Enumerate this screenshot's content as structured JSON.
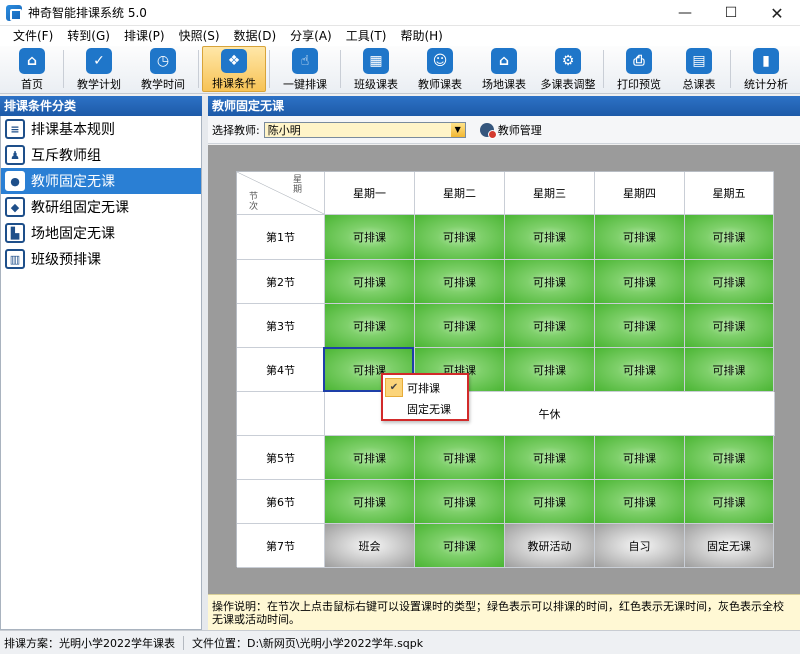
{
  "window": {
    "title": "神奇智能排课系统 5.0",
    "min": "—",
    "max": "☐",
    "close": "✕"
  },
  "menu": [
    "文件(F)",
    "转到(G)",
    "排课(P)",
    "快照(S)",
    "数据(D)",
    "分享(A)",
    "工具(T)",
    "帮助(H)"
  ],
  "toolbar": [
    {
      "label": "首页",
      "icon": "home-icon",
      "glyph": "⌂"
    },
    {
      "label": "教学计划",
      "icon": "clipboard-icon",
      "glyph": "✓"
    },
    {
      "label": "教学时间",
      "icon": "clock-icon",
      "glyph": "◷"
    },
    {
      "label": "排课条件",
      "icon": "conditions-icon",
      "glyph": "❖",
      "active": true
    },
    {
      "label": "一键排课",
      "icon": "hand-click-icon",
      "glyph": "☝"
    },
    {
      "label": "班级课表",
      "icon": "class-schedule-icon",
      "glyph": "▦"
    },
    {
      "label": "教师课表",
      "icon": "teacher-schedule-icon",
      "glyph": "☺"
    },
    {
      "label": "场地课表",
      "icon": "venue-schedule-icon",
      "glyph": "⌂"
    },
    {
      "label": "多课表调整",
      "icon": "multi-adjust-icon",
      "glyph": "⚙"
    },
    {
      "label": "打印预览",
      "icon": "printer-icon",
      "glyph": "⎙"
    },
    {
      "label": "总课表",
      "icon": "calendar-icon",
      "glyph": "▤"
    },
    {
      "label": "统计分析",
      "icon": "bar-chart-icon",
      "glyph": "▮"
    }
  ],
  "left_panel": {
    "header": "排课条件分类",
    "items": [
      {
        "label": "排课基本规则",
        "icon": "rules-icon",
        "glyph": "≡"
      },
      {
        "label": "互斥教师组",
        "icon": "mutex-teacher-icon",
        "glyph": "♟"
      },
      {
        "label": "教师固定无课",
        "icon": "teacher-icon",
        "glyph": "●",
        "selected": true
      },
      {
        "label": "教研组固定无课",
        "icon": "cube-icon",
        "glyph": "◆"
      },
      {
        "label": "场地固定无课",
        "icon": "venue-icon",
        "glyph": "▙"
      },
      {
        "label": "班级预排课",
        "icon": "book-icon",
        "glyph": "▥"
      }
    ]
  },
  "right_panel": {
    "header": "教师固定无课",
    "teacher_label": "选择教师:",
    "teacher_value": "陈小明",
    "teacher_mgr": "教师管理"
  },
  "schedule": {
    "corner_top": "星期",
    "corner_bottom": "节次",
    "days": [
      "星期一",
      "星期二",
      "星期三",
      "星期四",
      "星期五"
    ],
    "lunch_label": "午休",
    "rows": [
      {
        "period": "第1节",
        "cells": [
          "可排课",
          "可排课",
          "可排课",
          "可排课",
          "可排课"
        ],
        "kinds": [
          "green",
          "green",
          "green",
          "green",
          "green"
        ]
      },
      {
        "period": "第2节",
        "cells": [
          "可排课",
          "可排课",
          "可排课",
          "可排课",
          "可排课"
        ],
        "kinds": [
          "green",
          "green",
          "green",
          "green",
          "green"
        ]
      },
      {
        "period": "第3节",
        "cells": [
          "可排课",
          "可排课",
          "可排课",
          "可排课",
          "可排课"
        ],
        "kinds": [
          "green",
          "green",
          "green",
          "green",
          "green"
        ]
      },
      {
        "period": "第4节",
        "cells": [
          "可排课",
          "可排课",
          "可排课",
          "可排课",
          "可排课"
        ],
        "kinds": [
          "green",
          "green",
          "green",
          "green",
          "green"
        ]
      },
      {
        "period": "第5节",
        "cells": [
          "可排课",
          "可排课",
          "可排课",
          "可排课",
          "可排课"
        ],
        "kinds": [
          "green",
          "green",
          "green",
          "green",
          "green"
        ]
      },
      {
        "period": "第6节",
        "cells": [
          "可排课",
          "可排课",
          "可排课",
          "可排课",
          "可排课"
        ],
        "kinds": [
          "green",
          "green",
          "green",
          "green",
          "green"
        ]
      },
      {
        "period": "第7节",
        "cells": [
          "班会",
          "可排课",
          "教研活动",
          "自习",
          "固定无课"
        ],
        "kinds": [
          "gray",
          "green",
          "gray",
          "gray",
          "gray"
        ]
      }
    ]
  },
  "context_menu": {
    "items": [
      {
        "label": "可排课",
        "checked": true
      },
      {
        "label": "固定无课",
        "checked": false
      }
    ]
  },
  "instructions": "操作说明：在节次上点击鼠标右键可以设置课时的类型；绿色表示可以排课的时间，红色表示无课时间，灰色表示全校无课或活动时间。",
  "status": {
    "scheme": "排课方案：光明小学2022学年课表",
    "file": "文件位置：D:\\新网页\\光明小学2022学年.sqpk"
  }
}
